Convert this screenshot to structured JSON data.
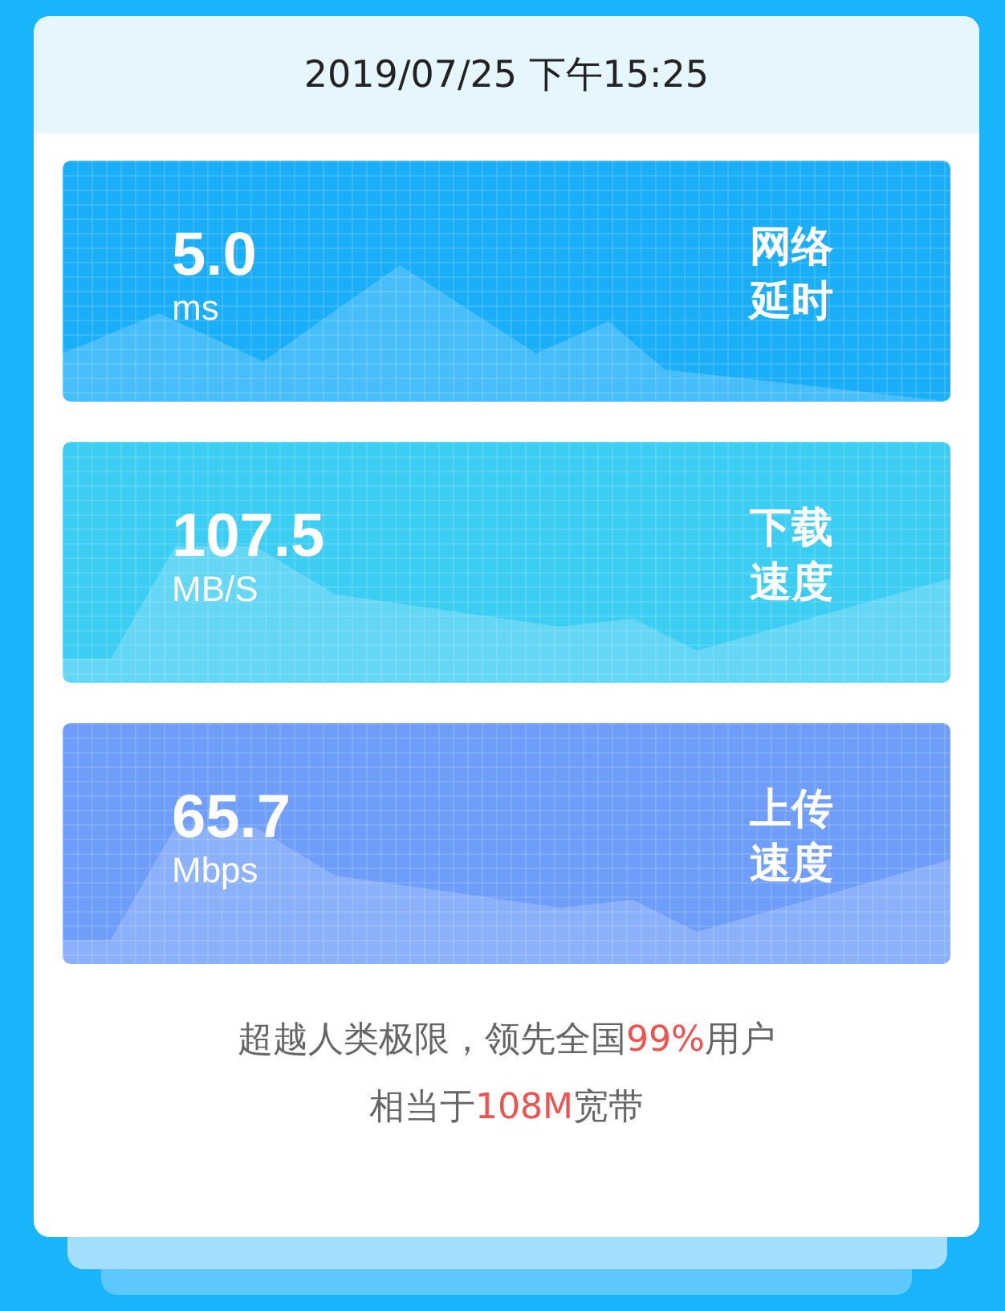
{
  "header": {
    "datetime": "2019/07/25 下午15:25"
  },
  "metrics": [
    {
      "value": "5.0",
      "unit": "ms",
      "label": "网络延时",
      "color": "#1aaef8"
    },
    {
      "value": "107.5",
      "unit": "MB/S",
      "label": "下载速度",
      "color": "#3ccdf2"
    },
    {
      "value": "65.7",
      "unit": "Mbps",
      "label": "上传速度",
      "color": "#6e9ef9"
    }
  ],
  "summary": [
    [
      {
        "text": "超越人类极限，领先全国",
        "highlight": false
      },
      {
        "text": "99%",
        "highlight": true
      },
      {
        "text": "用户",
        "highlight": false
      }
    ],
    [
      {
        "text": "相当于",
        "highlight": false
      },
      {
        "text": "108M",
        "highlight": true
      },
      {
        "text": "宽带",
        "highlight": false
      }
    ]
  ]
}
